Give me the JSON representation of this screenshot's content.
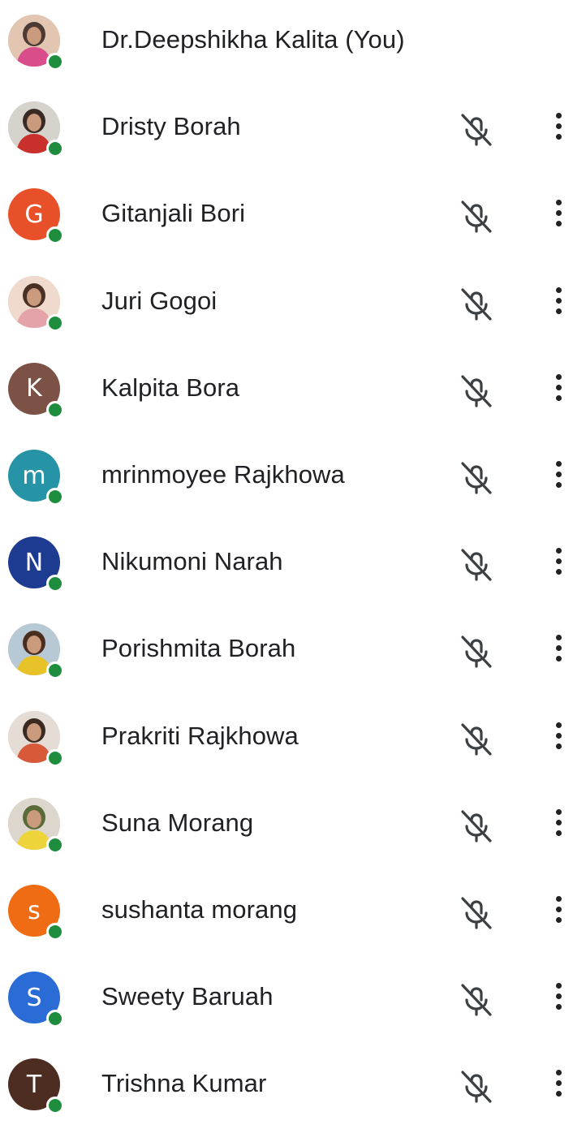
{
  "participants": [
    {
      "name": "Dr.Deepshikha Kalita (You)",
      "avatar_type": "photo",
      "avatar_colors": [
        "#e2c6b2",
        "#d94d8a",
        "#4a3a33"
      ],
      "presence": "online",
      "is_self": true
    },
    {
      "name": "Dristy Borah",
      "avatar_type": "photo",
      "avatar_colors": [
        "#d6d2cc",
        "#c9302c",
        "#3a2a24"
      ],
      "presence": "online",
      "mic": "muted",
      "more": "more-options"
    },
    {
      "name": "Gitanjali Bori",
      "avatar_type": "initial",
      "initial": "G",
      "avatar_color": "#e8502a",
      "presence": "online",
      "mic": "muted",
      "more": "more-options"
    },
    {
      "name": "Juri Gogoi",
      "avatar_type": "photo",
      "avatar_colors": [
        "#f0d9cd",
        "#e4a3a8",
        "#4a3125"
      ],
      "presence": "online",
      "mic": "muted",
      "more": "more-options"
    },
    {
      "name": "Kalpita Bora",
      "avatar_type": "initial",
      "initial": "K",
      "avatar_color": "#7b5245",
      "presence": "online",
      "mic": "muted",
      "more": "more-options"
    },
    {
      "name": "mrinmoyee Rajkhowa",
      "avatar_type": "initial",
      "initial": "m",
      "avatar_color": "#2694a6",
      "presence": "online",
      "mic": "muted",
      "more": "more-options"
    },
    {
      "name": "Nikumoni Narah",
      "avatar_type": "initial",
      "initial": "N",
      "avatar_color": "#1d3b91",
      "presence": "online",
      "mic": "muted",
      "more": "more-options"
    },
    {
      "name": "Porishmita Borah",
      "avatar_type": "photo",
      "avatar_colors": [
        "#b8c9d6",
        "#e7c229",
        "#4a2f20"
      ],
      "presence": "online",
      "mic": "muted",
      "more": "more-options"
    },
    {
      "name": "Prakriti Rajkhowa",
      "avatar_type": "photo",
      "avatar_colors": [
        "#e5dcd6",
        "#d8583a",
        "#3b2a22"
      ],
      "presence": "online",
      "mic": "muted",
      "more": "more-options"
    },
    {
      "name": "Suna Morang",
      "avatar_type": "photo",
      "avatar_colors": [
        "#ddd6cc",
        "#ecd43a",
        "#5a6b3a"
      ],
      "presence": "online",
      "mic": "muted",
      "more": "more-options"
    },
    {
      "name": "sushanta morang",
      "avatar_type": "initial",
      "initial": "s",
      "avatar_color": "#ef6c14",
      "presence": "online",
      "mic": "muted",
      "more": "more-options"
    },
    {
      "name": "Sweety Baruah",
      "avatar_type": "initial",
      "initial": "S",
      "avatar_color": "#2b6bd6",
      "presence": "online",
      "mic": "muted",
      "more": "more-options"
    },
    {
      "name": "Trishna Kumar",
      "avatar_type": "initial",
      "initial": "T",
      "avatar_color": "#4d2c22",
      "presence": "online",
      "mic": "muted",
      "more": "more-options"
    }
  ],
  "icons": {
    "mic_muted": "mic-off-icon",
    "more": "more-vert-icon",
    "presence": "online-dot"
  },
  "colors": {
    "text": "#202124",
    "presence_online": "#1e8e3e",
    "background": "#ffffff"
  }
}
